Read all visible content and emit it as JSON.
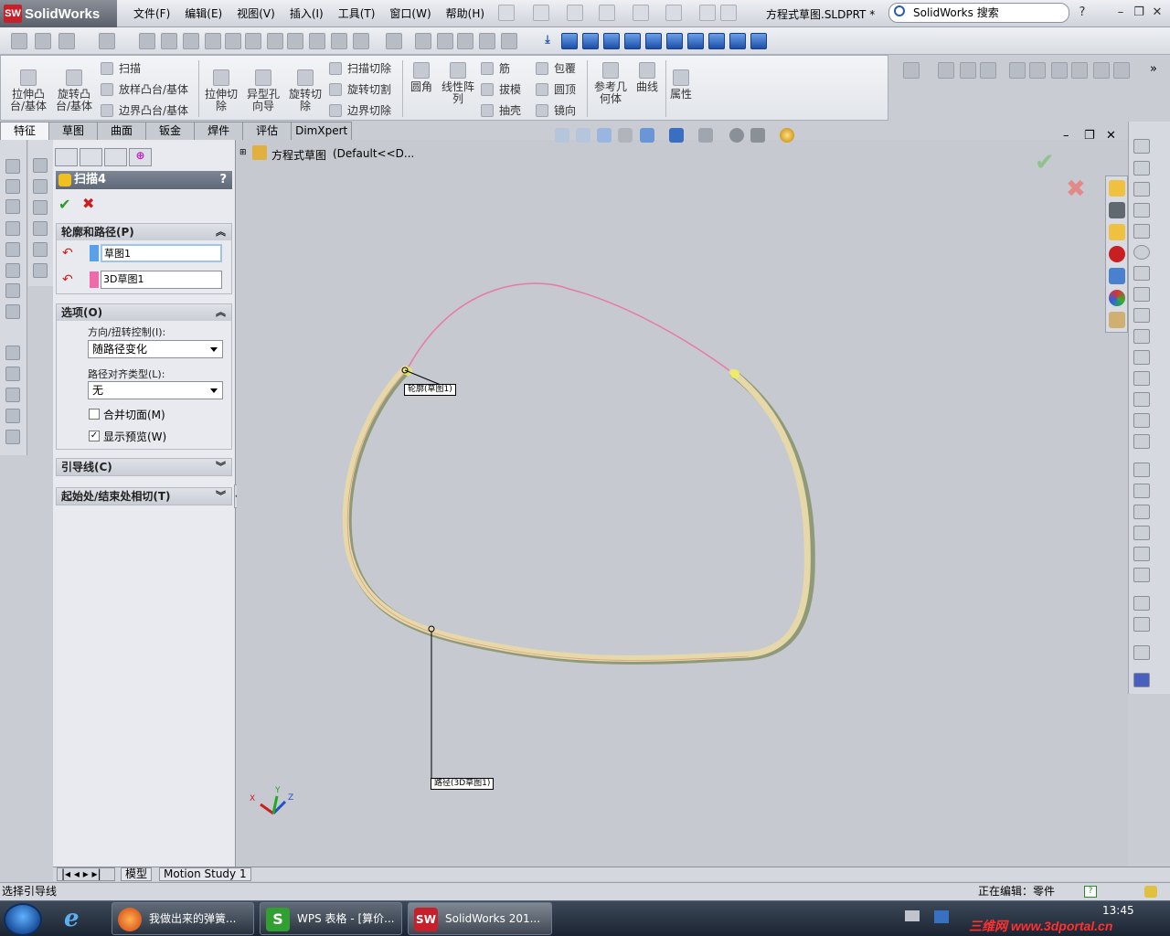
{
  "app": {
    "name": "SolidWorks",
    "file_title": "方程式草图.SLDPRT *",
    "search_placeholder": "SolidWorks 搜索",
    "help_mark": "?"
  },
  "menu": [
    "文件(F)",
    "编辑(E)",
    "视图(V)",
    "插入(I)",
    "工具(T)",
    "窗口(W)",
    "帮助(H)"
  ],
  "command_manager": {
    "large": [
      {
        "label": "拉伸凸\n台/基体"
      },
      {
        "label": "旋转凸\n台/基体"
      },
      {
        "label": "拉伸切\n除"
      },
      {
        "label": "异型孔\n向导"
      },
      {
        "label": "旋转切\n除"
      },
      {
        "label": "圆角"
      },
      {
        "label": "线性阵\n列"
      },
      {
        "label": "参考几\n何体"
      },
      {
        "label": "曲线"
      },
      {
        "label": "属性"
      }
    ],
    "small": {
      "sweep": "扫描",
      "loft": "放样凸台/基体",
      "boundary": "边界凸台/基体",
      "sweep_cut": "扫描切除",
      "loft_cut": "旋转切割",
      "boundary_cut": "边界切除",
      "rib": "筋",
      "draft": "拔模",
      "shell": "抽壳",
      "wrap": "包覆",
      "dome": "圆顶",
      "mirror": "镜向"
    }
  },
  "tabs": [
    "特征",
    "草图",
    "曲面",
    "钣金",
    "焊件",
    "评估",
    "DimXpert"
  ],
  "property_manager": {
    "title": "扫描4",
    "profile_group": {
      "title": "轮廓和路径(P)",
      "profile": "草图1",
      "path": "3D草图1",
      "profile_color": "#5aa0e8",
      "path_color": "#ee6aa8"
    },
    "options_group": {
      "title": "选项(O)",
      "orientation_label": "方向/扭转控制(I):",
      "orientation_value": "随路径变化",
      "alignment_label": "路径对齐类型(L):",
      "alignment_value": "无",
      "merge_faces": {
        "label": "合并切面(M)",
        "checked": false
      },
      "show_preview": {
        "label": "显示预览(W)",
        "checked": true
      }
    },
    "guide_group": {
      "title": "引导线(C)"
    },
    "tangency_group": {
      "title": "起始处/结束处相切(T)"
    }
  },
  "tree": {
    "root": "方程式草图",
    "config": "(Default<<D..."
  },
  "viewport": {
    "profile_callout": "轮廓(草图1)",
    "path_callout": "路径(3D草图1)",
    "axis_labels": [
      "X",
      "Y",
      "Z"
    ]
  },
  "bottom_tabs": [
    "模型",
    "Motion Study 1"
  ],
  "status": {
    "left": "选择引导线",
    "right": "正在编辑：零件"
  },
  "taskbar": {
    "items": [
      "我做出来的弹簧...",
      "WPS 表格 - [算价...",
      "SolidWorks 201..."
    ],
    "time": "13:45",
    "watermark": "三维网 www.3dportal.cn"
  },
  "colors": {
    "path_curve": "#e878a8",
    "sweep_body": "#e6d8a8",
    "sweep_shadow": "#9aa280",
    "ok_green": "#2b9a2b",
    "cancel_red": "#c82020"
  }
}
